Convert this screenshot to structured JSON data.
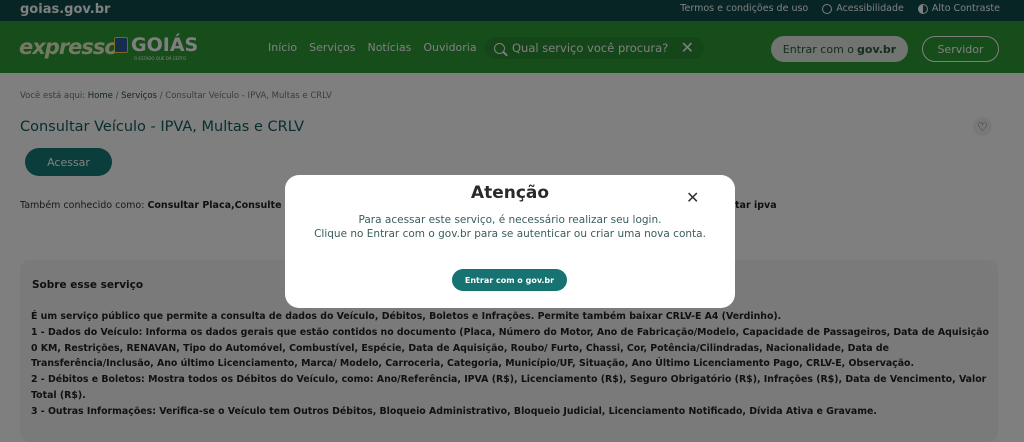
{
  "topbar": {
    "site": "goias.gov.br",
    "terms": "Termos e condições de uso",
    "accessibility": "Acessibilidade",
    "contrast": "Alto Contraste"
  },
  "header": {
    "logo_expresso": "expresso",
    "logo_goias": "GOIÁS",
    "logo_goias_sub": "O ESTADO QUE DÁ CERTO",
    "nav": [
      "Início",
      "Serviços",
      "Notícias",
      "Ouvidoria"
    ],
    "search_placeholder": "Qual serviço você procura?",
    "login_prefix": "Entrar com o",
    "login_brand": "gov.br",
    "servidor": "Servidor"
  },
  "breadcrumb": {
    "prefix": "Você está aqui:",
    "home": "Home",
    "services": "Serviços",
    "current": "Consultar Veículo - IPVA, Multas e CRLV"
  },
  "page": {
    "title": "Consultar Veículo - IPVA, Multas e CRLV",
    "access_button": "Acessar",
    "aka_prefix": "Também conhecido como:",
    "aka_value": "Consultar Placa,Consulte",
    "aka_tail": "ultar ipva"
  },
  "about": {
    "title": "Sobre esse serviço",
    "lines": [
      "É um serviço público que permite a consulta de dados do Veículo, Débitos, Boletos e Infrações.  Permite também baixar CRLV-E A4 (Verdinho).",
      "1 - Dados do Veículo: Informa os dados gerais que estão contidos no documento (Placa, Número do Motor, Ano de Fabricação/Modelo, Capacidade de Passageiros, Data de Aquisição 0 KM, Restrições, RENAVAN, Tipo do Automóvel, Combustível, Espécie, Data de Aquisição, Roubo/ Furto, Chassi, Cor, Potência/Cilindradas, Nacionalidade, Data de Transferência/Inclusão, Ano último Licenciamento, Marca/ Modelo, Carroceria, Categoria, Município/UF, Situação, Ano Último Licenciamento Pago, CRLV-E, Observação.",
      "2 - Débitos e Boletos: Mostra todos os Débitos do Veículo, como: Ano/Referência, IPVA (R$), Licenciamento (R$), Seguro Obrigatório (R$), Infrações (R$), Data de Vencimento, Valor Total (R$).",
      "3 - Outras Informações: Verifica-se o Veículo tem Outros Débitos, Bloqueio Administrativo, Bloqueio Judicial, Licenciamento Notificado, Dívida Ativa e Gravame."
    ]
  },
  "modal": {
    "title": "Atenção",
    "line1": "Para acessar este serviço, é necessário realizar seu login.",
    "line2": "Clique no Entrar com o gov.br para se autenticar ou criar uma nova conta.",
    "button": "Entrar com o gov.br"
  },
  "colors": {
    "header_green": "#2f9a37",
    "topbar": "#0e4a4a",
    "teal": "#177a7a"
  }
}
